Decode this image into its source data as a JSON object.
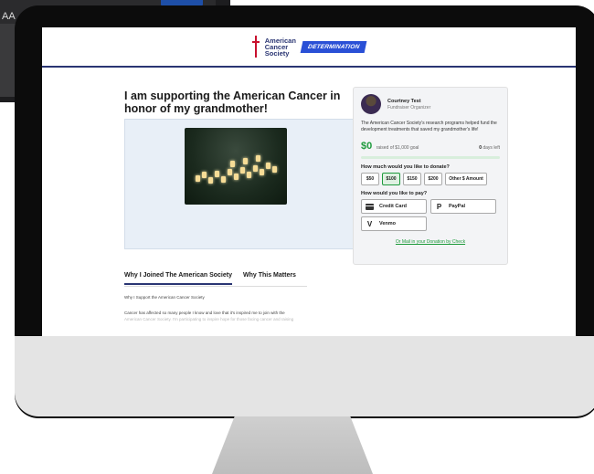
{
  "background_monitor": {
    "partial_text": "AA"
  },
  "header": {
    "logo_lines": [
      "American",
      "Cancer",
      "Society"
    ],
    "badge": "DETERMINATION"
  },
  "page": {
    "headline": "I am supporting the American Cancer in honor of my grandmother!",
    "tabs": [
      {
        "label": "Why I Joined The American Society",
        "active": true
      },
      {
        "label": "Why This Matters",
        "active": false
      }
    ],
    "body_heading": "Why I Support the American Cancer Society",
    "body_text": "Cancer has affected so many people I know and love that it's inspired me to join with the",
    "body_text_faded": "American Cancer Society. I'm participating to inspire hope for those facing cancer and raising"
  },
  "donation_card": {
    "organizer_name": "Courtney Test",
    "organizer_role": "Fundraiser Organizer",
    "story": "The American Cancer Society's research programs helped fund the development treatments that saved my grandmother's life!",
    "raised_amount": "$0",
    "raised_goal": "raised of $1,000 goal",
    "days_value": "0",
    "days_label": "days left",
    "progress_fraction": 0,
    "amount_question": "How much would you like to donate?",
    "amounts": [
      {
        "label": "$50",
        "selected": false
      },
      {
        "label": "$100",
        "selected": true
      },
      {
        "label": "$150",
        "selected": false
      },
      {
        "label": "$200",
        "selected": false
      }
    ],
    "other_amount": "Other $ Amount",
    "pay_question": "How would you like to pay?",
    "payment_methods": [
      {
        "label": "Credit Card",
        "icon": "credit-card-icon"
      },
      {
        "label": "PayPal",
        "icon": "paypal-icon"
      },
      {
        "label": "Venmo",
        "icon": "venmo-icon"
      }
    ],
    "mail_link": "Or Mail in your Donation by Check"
  },
  "colors": {
    "brand_navy": "#2a3573",
    "brand_red": "#c8102e",
    "accent_green": "#1e9a3c",
    "badge_blue": "#2a50d6"
  }
}
